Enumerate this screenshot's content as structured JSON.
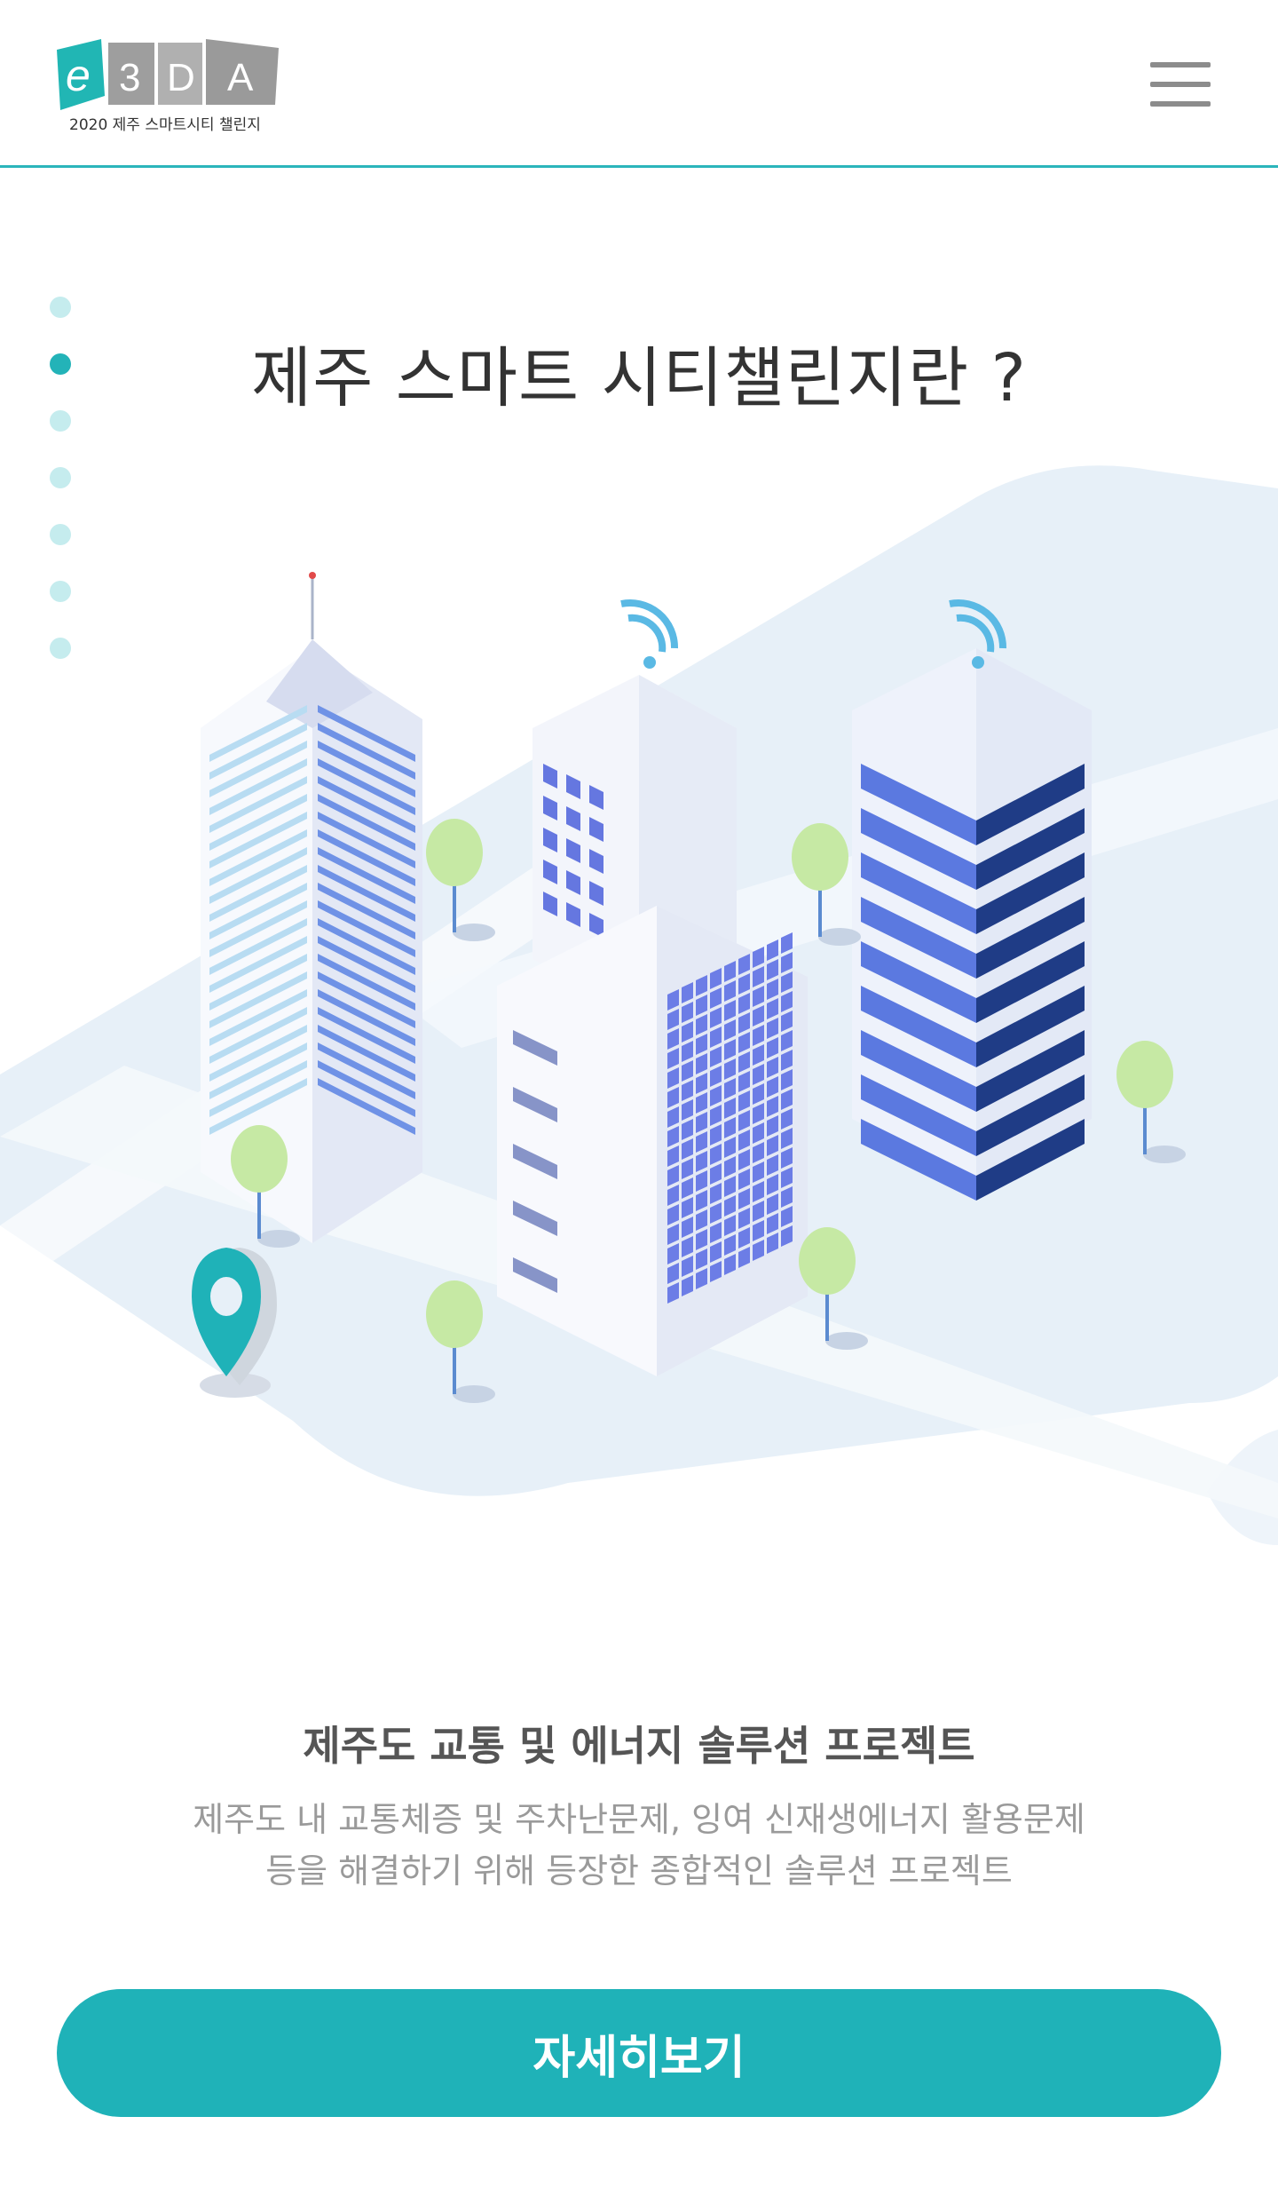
{
  "header": {
    "logo_letters": [
      "e",
      "3",
      "D",
      "A"
    ],
    "logo_subtitle": "2020 제주 스마트시티 챌린지",
    "menu_icon": "hamburger-menu-icon"
  },
  "pagination": {
    "count": 7,
    "active_index": 1
  },
  "main": {
    "title": "제주 스마트 시티챌린지란 ?",
    "subtitle": "제주도 교통 및 에너지 솔루션 프로젝트",
    "description_line1": "제주도 내  교통체증 및 주차난문제, 잉여 신재생에너지 활용문제",
    "description_line2": "등을 해결하기 위해 등장한 종합적인 솔루션 프로젝트",
    "cta_label": "자세히보기"
  },
  "colors": {
    "accent": "#1fb2b8",
    "header_line": "#2bb5bb",
    "dot_inactive": "#c5ecee",
    "dot_active": "#23b3b8"
  }
}
